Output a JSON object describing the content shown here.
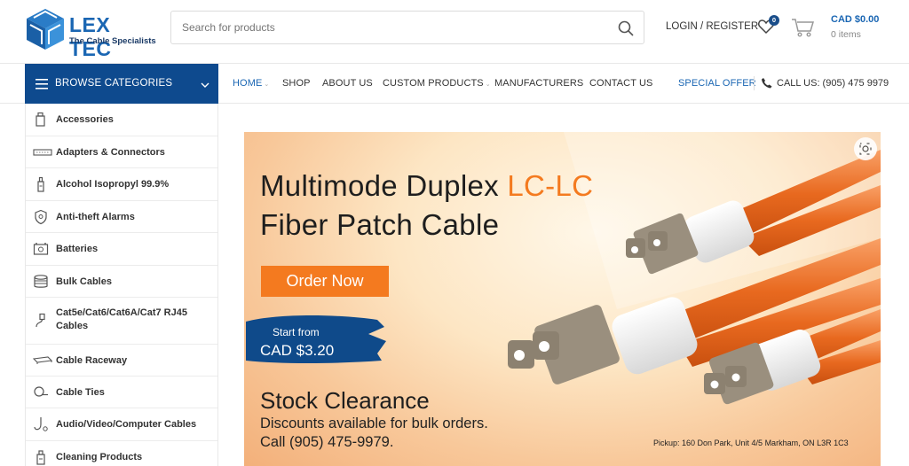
{
  "brand": {
    "name": "LEX TEC",
    "tagline": "The Cable Specialists"
  },
  "search": {
    "placeholder": "Search for products"
  },
  "account": {
    "login_label": "LOGIN / REGISTER",
    "wishlist_count": "0",
    "cart_total": "CAD $0.00",
    "cart_items": "0 items"
  },
  "nav": {
    "browse_label": "BROWSE CATEGORIES",
    "links": [
      "HOME",
      "SHOP",
      "ABOUT US",
      "CUSTOM PRODUCTS",
      "MANUFACTURERS",
      "CONTACT US"
    ],
    "special_offer": "SPECIAL OFFER",
    "call_us": "CALL US: (905) 475 9979"
  },
  "categories": [
    {
      "label": "Accessories",
      "icon": "accessories-icon"
    },
    {
      "label": "Adapters & Connectors",
      "icon": "adapter-icon"
    },
    {
      "label": "Alcohol Isopropyl 99.9%",
      "icon": "bottle-icon"
    },
    {
      "label": "Anti-theft Alarms",
      "icon": "shield-icon"
    },
    {
      "label": "Batteries",
      "icon": "battery-icon"
    },
    {
      "label": "Bulk Cables",
      "icon": "cable-spool-icon"
    },
    {
      "label": "Cat5e/Cat6/Cat6A/Cat7 RJ45",
      "label2": "Cables",
      "icon": "rj45-icon"
    },
    {
      "label": "Cable Raceway",
      "icon": "raceway-icon"
    },
    {
      "label": "Cable Ties",
      "icon": "cable-tie-icon"
    },
    {
      "label": "Audio/Video/Computer Cables",
      "icon": "av-cable-icon"
    },
    {
      "label": "Cleaning Products",
      "icon": "cleaning-icon"
    }
  ],
  "hero": {
    "title_part1": "Multimode Duplex ",
    "title_accent": "LC-LC",
    "title_line2": "Fiber Patch Cable",
    "button": "Order Now",
    "start_from": "Start from",
    "price": "CAD $3.20",
    "stock": "Stock Clearance",
    "discount": "Discounts available for bulk orders.",
    "call": "Call (905) 475-9979.",
    "pickup": "Pickup: 160 Don Park, Unit 4/5 Markham,  ON L3R 1C3"
  },
  "colors": {
    "brand_blue": "#0e4a8e",
    "accent_orange": "#f47a1f",
    "link_blue": "#1a66b3"
  }
}
